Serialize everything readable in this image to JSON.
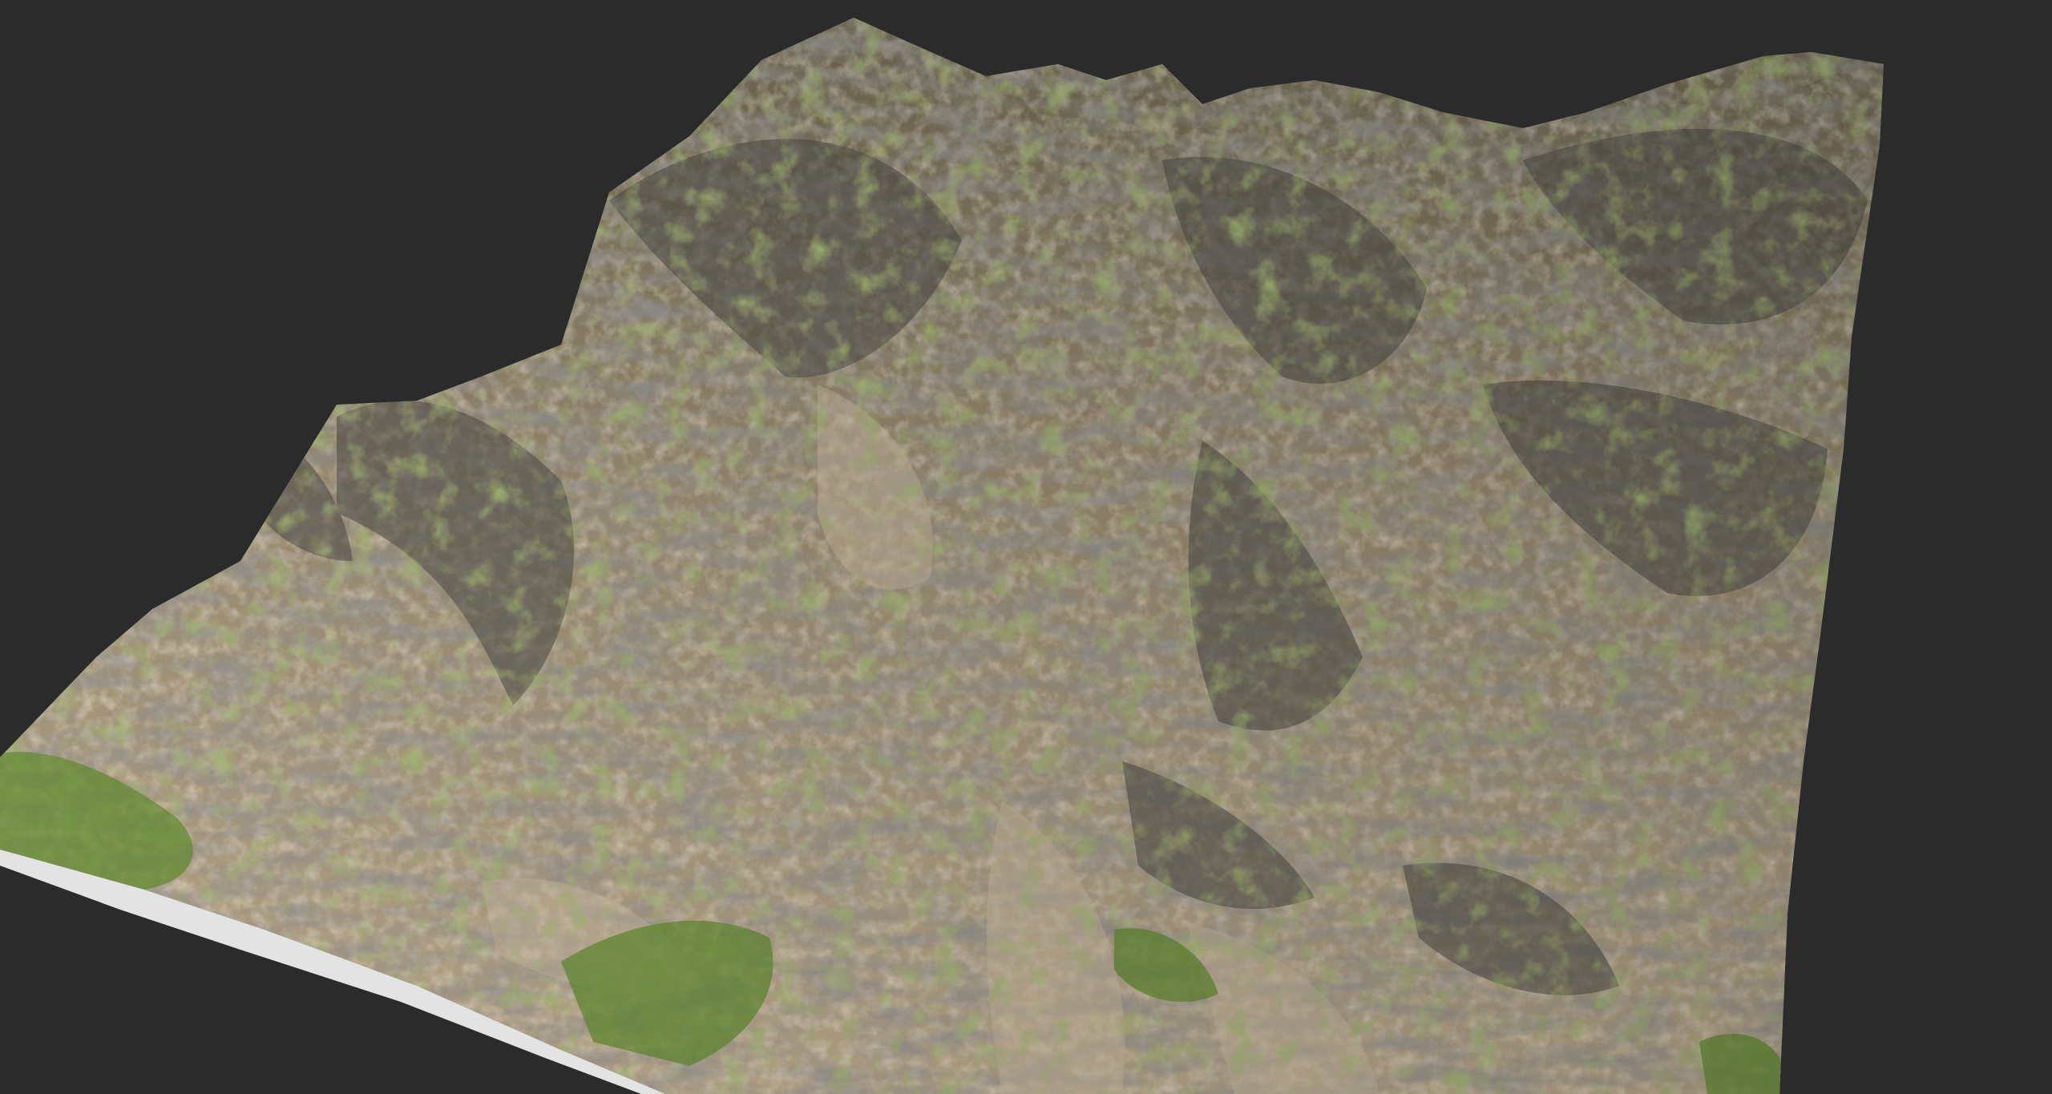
{
  "viewport": {
    "background_color": "#2b2b2b",
    "content": "3d-terrain-render"
  },
  "terrain": {
    "colors": {
      "sand": "#b8a488",
      "light_sand": "#cbbda6",
      "rock_dark": "#4e4d4c",
      "rock_mid": "#7a6e5a",
      "moss": "#6f7a3a",
      "grass": "#5f8a2e",
      "snow_edge": "#e6e6e6"
    }
  }
}
